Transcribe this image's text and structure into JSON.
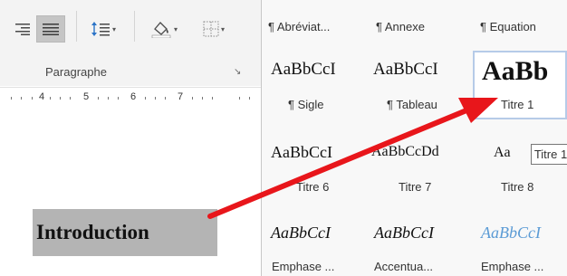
{
  "ribbon": {
    "group_label": "Paragraphe",
    "launcher_symbol": "↘",
    "ruler_numbers": [
      "4",
      "5",
      "6",
      "7"
    ]
  },
  "styles_gallery": {
    "row1": [
      {
        "name": "¶ Abréviat..."
      },
      {
        "name": "¶ Annexe"
      },
      {
        "name": "¶ Equation"
      }
    ],
    "row2": [
      {
        "preview": "AaBbCcI",
        "name": "¶ Sigle"
      },
      {
        "preview": "AaBbCcI",
        "name": "¶ Tableau"
      },
      {
        "preview": "AaBb",
        "name": "Titre 1"
      }
    ],
    "row3": [
      {
        "preview": "AaBbCcI",
        "name": "Titre 6"
      },
      {
        "preview": "AaBbCcDd",
        "name": "Titre 7"
      },
      {
        "preview": "Aa",
        "name": "Titre 8"
      }
    ],
    "row4": [
      {
        "preview": "AaBbCcI",
        "name": "Emphase ..."
      },
      {
        "preview": "AaBbCcI",
        "name": "Accentua..."
      },
      {
        "preview": "AaBbCcI",
        "name": "Emphase ..."
      }
    ]
  },
  "tooltip": {
    "text": "Titre 1"
  },
  "document": {
    "heading": "Introduction"
  },
  "colors": {
    "arrow": "#e8161b",
    "emphase_blue": "#5b9bd5",
    "selection_border": "#b6cbe8",
    "heading_highlight": "#b4b4b4"
  }
}
